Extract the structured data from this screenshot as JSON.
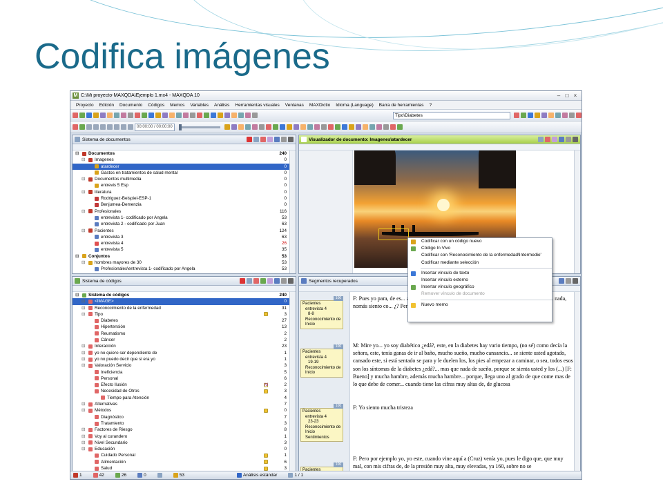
{
  "slide": {
    "title": "Codifica imágenes"
  },
  "window": {
    "title": "C:\\Mi proyecto-MAXQDA\\Ejemplo 1.mx4 - MAXQDA 10",
    "min": "–",
    "max": "□",
    "close": "×"
  },
  "menu": [
    "Proyecto",
    "Edición",
    "Documento",
    "Códigos",
    "Memos",
    "Variables",
    "Análisis",
    "Herramientas visuales",
    "Ventanas",
    "MAXDictio",
    "Idioma (Language)",
    "Barra de herramientas",
    "?"
  ],
  "toolbar": {
    "variable_select": "Tipo\\Diabetes",
    "time": "00:00:00 / 00:00:00"
  },
  "documents_pane": {
    "title": "Sistema de documentos",
    "rows": [
      {
        "label": "Documentos",
        "num": "240",
        "level": 0,
        "bold": true,
        "color": "#c0392b"
      },
      {
        "label": "Imagenes",
        "num": "0",
        "level": 1,
        "color": "#c0392b"
      },
      {
        "label": "atardecer",
        "num": "0",
        "level": 2,
        "hl": true,
        "color": "#d9a31b"
      },
      {
        "label": "Gastos en tratamientos de salud mental",
        "num": "0",
        "level": 2,
        "color": "#d9a31b"
      },
      {
        "label": "Documentos multimedia",
        "num": "0",
        "level": 1,
        "color": "#c0392b"
      },
      {
        "label": "entrevis 5 Esp",
        "num": "0",
        "level": 2,
        "color": "#d9a31b"
      },
      {
        "label": "literatura",
        "num": "0",
        "level": 1,
        "color": "#c0392b"
      },
      {
        "label": "Rodriguez-Beispiel-ESP-1",
        "num": "0",
        "level": 2,
        "color": "#c23a3a"
      },
      {
        "label": "Benjumea-Demenzia",
        "num": "0",
        "level": 2,
        "color": "#c23a3a"
      },
      {
        "label": "Profesionales",
        "num": "116",
        "level": 1,
        "color": "#c0392b"
      },
      {
        "label": "entrevista 1- codificado por Angela",
        "num": "53",
        "level": 2,
        "color": "#5a7cc0"
      },
      {
        "label": "entrevista 2 - codificado por Juan",
        "num": "63",
        "level": 2,
        "color": "#5a7cc0"
      },
      {
        "label": "Pacientes",
        "num": "124",
        "level": 1,
        "color": "#c0392b"
      },
      {
        "label": "entrevista 3",
        "num": "63",
        "level": 2,
        "color": "#5a7cc0"
      },
      {
        "label": "entrevista 4",
        "num": "26",
        "level": 2,
        "red": true,
        "color": "#e05050"
      },
      {
        "label": "entrevista 5",
        "num": "35",
        "level": 2,
        "color": "#5a7cc0"
      },
      {
        "label": "Conjuntos",
        "num": "53",
        "level": 0,
        "bold": true,
        "color": "#d9a31b"
      },
      {
        "label": "hombres mayores de 30",
        "num": "53",
        "level": 1,
        "color": "#d9a31b"
      },
      {
        "label": "Profesionales\\entrevista 1- codificado por Angela",
        "num": "53",
        "level": 2,
        "color": "#5a7cc0"
      }
    ]
  },
  "codes_pane": {
    "title": "Sistema de códigos",
    "rows": [
      {
        "label": "Sistema de códigos",
        "num": "240",
        "level": 0,
        "bold": true,
        "color": "#6aa84f"
      },
      {
        "label": "<IMAGE>",
        "num": "0",
        "level": 1,
        "hl": true,
        "color": "#e06666"
      },
      {
        "label": "Reconocimiento de la enfermedad",
        "num": "31",
        "level": 1,
        "color": "#e06666",
        "memo": false
      },
      {
        "label": "Tipo",
        "num": "3",
        "level": 1,
        "color": "#e06666",
        "memo": "y"
      },
      {
        "label": "Diabetes",
        "num": "27",
        "level": 2,
        "color": "#e06666"
      },
      {
        "label": "Hipertensión",
        "num": "13",
        "level": 2,
        "color": "#e06666"
      },
      {
        "label": "Reumatismo",
        "num": "2",
        "level": 2,
        "color": "#e06666"
      },
      {
        "label": "Cáncer",
        "num": "2",
        "level": 2,
        "color": "#e06666"
      },
      {
        "label": "Interacción",
        "num": "23",
        "level": 1,
        "color": "#e06666"
      },
      {
        "label": "yo no quiero ser dependiente de",
        "num": "1",
        "level": 1,
        "color": "#e06666"
      },
      {
        "label": "yo no puedo decir que si era yo",
        "num": "1",
        "level": 1,
        "color": "#e06666"
      },
      {
        "label": "Valoración Servicio",
        "num": "3",
        "level": 1,
        "color": "#e06666"
      },
      {
        "label": "Ineficiencia",
        "num": "5",
        "level": 2,
        "color": "#e06666"
      },
      {
        "label": "Personal",
        "num": "6",
        "level": 2,
        "color": "#e06666"
      },
      {
        "label": "Efecto Ilusión",
        "num": "2",
        "level": 2,
        "color": "#e06666",
        "memo": "m"
      },
      {
        "label": "Necesidad de Otros",
        "num": "3",
        "level": 2,
        "color": "#e06666",
        "memo": "p"
      },
      {
        "label": "Tiempo para Atención",
        "num": "4",
        "level": 3,
        "color": "#e06666"
      },
      {
        "label": "Alternativas",
        "num": "7",
        "level": 1,
        "color": "#e06666"
      },
      {
        "label": "Métodos",
        "num": "0",
        "level": 1,
        "color": "#e06666",
        "memo": "y"
      },
      {
        "label": "Diagnóstico",
        "num": "7",
        "level": 2,
        "color": "#e06666"
      },
      {
        "label": "Tratamiento",
        "num": "3",
        "level": 2,
        "color": "#e06666"
      },
      {
        "label": "Factores de Riesgo",
        "num": "8",
        "level": 1,
        "color": "#e06666"
      },
      {
        "label": "Voy al curandero",
        "num": "1",
        "level": 1,
        "color": "#e06666"
      },
      {
        "label": "Nivel Secundario",
        "num": "3",
        "level": 1,
        "color": "#e06666"
      },
      {
        "label": "Educación",
        "num": "0",
        "level": 1,
        "color": "#e06666"
      },
      {
        "label": "Cuidado Personal",
        "num": "1",
        "level": 2,
        "color": "#e06666",
        "memo": "y"
      },
      {
        "label": "Alimentación",
        "num": "6",
        "level": 2,
        "color": "#e06666",
        "memo": "y"
      },
      {
        "label": "Salud",
        "num": "3",
        "level": 2,
        "color": "#e06666",
        "memo": "y"
      }
    ]
  },
  "viewer_pane": {
    "title": "Visualizador de documento: Imagenes\\atardecer"
  },
  "context_menu": {
    "items": [
      {
        "label": "Codificar con un código nuevo",
        "color": "#d9a31b"
      },
      {
        "label": "Código In Vivo",
        "color": "#6aa84f"
      },
      {
        "label": "Codificar con 'Reconocimiento de la enfermedad\\Intermedio'",
        "color": ""
      },
      {
        "label": "Codificar mediante selección",
        "color": ""
      },
      {
        "sep": true
      },
      {
        "label": "Insertar vínculo de texto",
        "color": "#3c78d8"
      },
      {
        "label": "Insertar vínculo externo",
        "color": ""
      },
      {
        "label": "Insertar vínculo geográfico",
        "color": "#6aa84f"
      },
      {
        "label": "Remover vínculo de documento",
        "color": "",
        "dis": true
      },
      {
        "sep": true
      },
      {
        "label": "Nuevo memo",
        "color": "#f1c232"
      }
    ]
  },
  "segments_pane": {
    "title": "Segmentos recuperados",
    "segments": [
      {
        "weight": "100",
        "lines": [
          "Pacientes",
          "entrevista 4",
          "8-8",
          "Reconocimiento de",
          "Inicio"
        ]
      },
      {
        "weight": "100",
        "lines": [
          "Pacientes",
          "entrevista 4",
          "19-19",
          "Reconocimiento de",
          "Inicio"
        ]
      },
      {
        "weight": "100",
        "lines": [
          "Pacientes",
          "entrevista 4",
          "23-23",
          "Reconocimiento de",
          "Inicio",
          "Sentimientos"
        ]
      },
      {
        "weight": "100",
        "lines": [
          "Pacientes",
          "entrevista 4"
        ]
      }
    ],
    "texts": [
      "F: Pues yo para, de es... análisis y me dice que (...) el an... no, no! (...) y ya salí con (...) y... nada, nomás siento co... ¿? Pero la cabeza no",
      "M: Mire yo... yo soy diabético ¿edá?, este, en la diabetes hay vario tiempo, (no sé) como decía la señora, este, tenía ganas de ir al baño, mucho sueño, mucho cansancio... se siente usted agotado, cansado este, si está sentado se para y le duelen los, los pies al empezar a caminar, o sea, todos esos son los síntomas de la diabetes ¿edá?... mas que nada de sueño, porque se sienta usted y los (...) [F: Bueno] y mucha hambre, además mucha hambre... porque, llega uno al grado de que come mas de lo que debe de comer... cuando tiene las cifras muy altas de, de glucosa",
      "F: Yo siento mucha tristeza",
      "F: Pero por ejemplo yo, yo este, cuando vine aquí a (Cruz) venía yo, pues le digo que, que muy mal, con mis cifras de, de la presión muy alta, muy elevadas, ya 160, sobre no se"
    ]
  },
  "status": {
    "docs": "1",
    "codes": "42",
    "segments": "26",
    "memos": "0",
    "set": "53",
    "analysis": "Análisis estándar",
    "page": "1 / 1"
  },
  "colors": {
    "title": "#1a6a8a",
    "accent": "#3166c7",
    "viewer_header": "#a8d04a"
  }
}
